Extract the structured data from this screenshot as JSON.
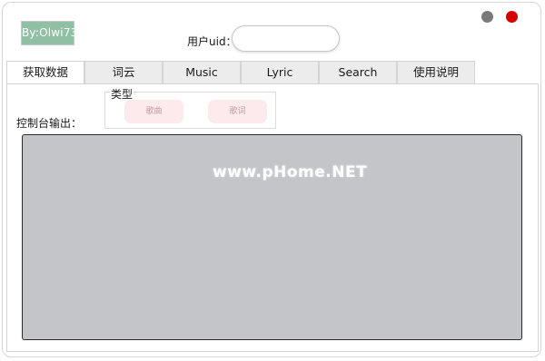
{
  "app": {
    "logo_text": "By:Olwi73"
  },
  "header": {
    "uid_label": "用户uid：",
    "uid_value": "",
    "uid_placeholder": ""
  },
  "tabs": [
    {
      "label": "获取数据",
      "active": true
    },
    {
      "label": "词云",
      "active": false
    },
    {
      "label": "Music",
      "active": false
    },
    {
      "label": "Lyric",
      "active": false
    },
    {
      "label": "Search",
      "active": false
    },
    {
      "label": "使用说明",
      "active": false
    }
  ],
  "type_group": {
    "legend": "类型",
    "buttons": [
      "歌曲",
      "歌词"
    ]
  },
  "console": {
    "label": "控制台输出：",
    "content": ""
  },
  "watermark": "www.pHome.NET",
  "colors": {
    "logo_bg": "#8fc0a4",
    "minimize": "#7a7a7a",
    "close": "#d60000",
    "type_button_bg": "#fdeaec",
    "console_bg": "#c4c5c9"
  }
}
